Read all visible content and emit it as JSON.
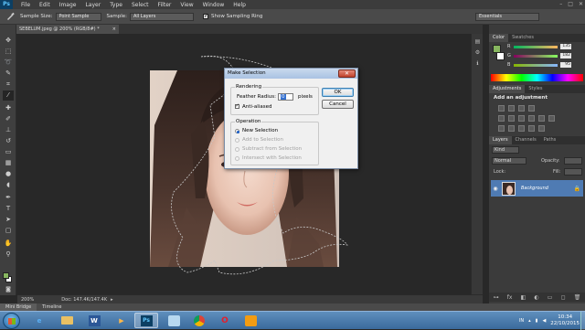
{
  "app": {
    "logo": "Ps",
    "menu": [
      "File",
      "Edit",
      "Image",
      "Layer",
      "Type",
      "Select",
      "Filter",
      "View",
      "Window",
      "Help"
    ],
    "window_controls": [
      "–",
      "□",
      "✕"
    ]
  },
  "options_bar": {
    "sample_size_label": "Sample Size:",
    "sample_size_value": "Point Sample",
    "sample_label": "Sample:",
    "sample_value": "All Layers",
    "show_ring_label": "Show Sampling Ring",
    "workspace": "Essentials"
  },
  "document": {
    "tab_title": "SEBELUM.jpeg @ 200% (RGB/8#) *",
    "tab_close": "×",
    "zoom": "200%",
    "doc_size": "Doc: 147.4K/147.4K"
  },
  "bottom_tabs": [
    "Mini Bridge",
    "Timeline"
  ],
  "color_panel": {
    "tabs": [
      "Color",
      "Swatches"
    ],
    "r_label": "R",
    "g_label": "G",
    "b_label": "B",
    "r": "135",
    "g": "182",
    "b": "95",
    "fg_color": "#87b65f",
    "bg_color": "#ffffff"
  },
  "adjustments_panel": {
    "tabs": [
      "Adjustments",
      "Styles"
    ],
    "heading": "Add an adjustment"
  },
  "layers_panel": {
    "tabs": [
      "Layers",
      "Channels",
      "Paths"
    ],
    "kind_filter": "Kind",
    "blend_mode": "Normal",
    "opacity_label": "Opacity:",
    "lock_label": "Lock:",
    "fill_label": "Fill:",
    "layer_name": "Background"
  },
  "dialog": {
    "title": "Make Selection",
    "close": "✕",
    "rendering_group": "Rendering",
    "feather_label": "Feather Radius:",
    "feather_value": "0",
    "feather_unit": "pixels",
    "anti_aliased_label": "Anti-aliased",
    "operation_group": "Operation",
    "op_new": "New Selection",
    "op_add": "Add to Selection",
    "op_subtract": "Subtract from Selection",
    "op_intersect": "Intersect with Selection",
    "ok": "OK",
    "cancel": "Cancel"
  },
  "taskbar": {
    "lang": "IN",
    "time": "10:34",
    "date": "22/10/2015"
  }
}
